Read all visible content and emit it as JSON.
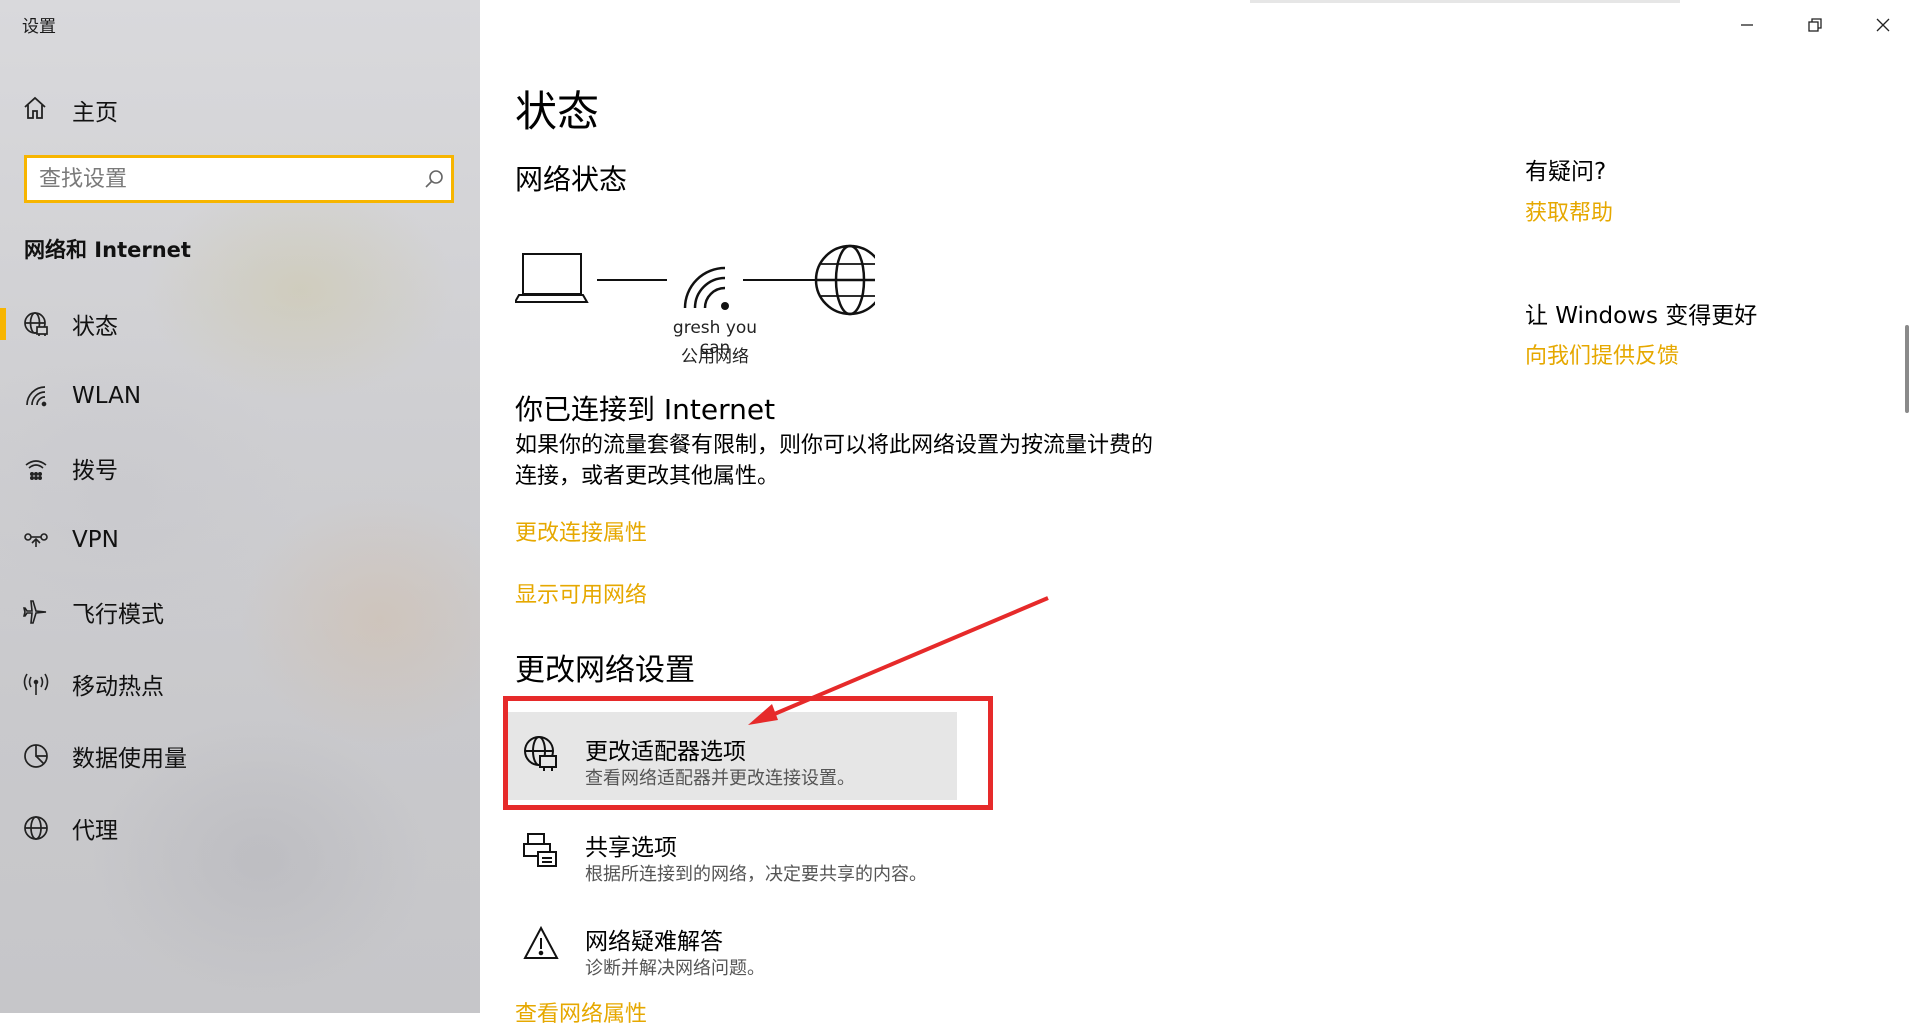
{
  "window": {
    "title": "设置",
    "minimize_glyph": "—",
    "restore_glyph": "❐",
    "close_glyph": "✕"
  },
  "sidebar": {
    "home_label": "主页",
    "search_placeholder": "查找设置",
    "section_title": "网络和 Internet",
    "items": [
      {
        "label": "状态",
        "icon": "globe-status-icon",
        "active": true
      },
      {
        "label": "WLAN",
        "icon": "wifi-icon"
      },
      {
        "label": "拨号",
        "icon": "dialup-icon"
      },
      {
        "label": "VPN",
        "icon": "vpn-icon"
      },
      {
        "label": "飞行模式",
        "icon": "airplane-icon"
      },
      {
        "label": "移动热点",
        "icon": "hotspot-icon"
      },
      {
        "label": "数据使用量",
        "icon": "data-usage-icon"
      },
      {
        "label": "代理",
        "icon": "globe-icon"
      }
    ]
  },
  "main": {
    "title": "状态",
    "network_status_heading": "网络状态",
    "network_name": "gresh you can",
    "network_type": "公用网络",
    "connected_text": "你已连接到 Internet",
    "description": "如果你的流量套餐有限制，则你可以将此网络设置为按流量计费的连接，或者更改其他属性。",
    "link_change_properties": "更改连接属性",
    "link_show_networks": "显示可用网络",
    "change_settings_heading": "更改网络设置",
    "options": [
      {
        "title": "更改适配器选项",
        "desc": "查看网络适配器并更改连接设置。",
        "icon": "adapter-globe-icon",
        "selected": true
      },
      {
        "title": "共享选项",
        "desc": "根据所连接到的网络，决定要共享的内容。",
        "icon": "sharing-icon"
      },
      {
        "title": "网络疑难解答",
        "desc": "诊断并解决网络问题。",
        "icon": "warning-icon"
      }
    ],
    "link_view_properties": "查看网络属性"
  },
  "aside": {
    "question": "有疑问?",
    "help_link": "获取帮助",
    "improve": "让 Windows 变得更好",
    "feedback_link": "向我们提供反馈"
  },
  "colors": {
    "accent": "#f7b500",
    "link": "#e6a800",
    "annotation": "#e62a2a"
  }
}
